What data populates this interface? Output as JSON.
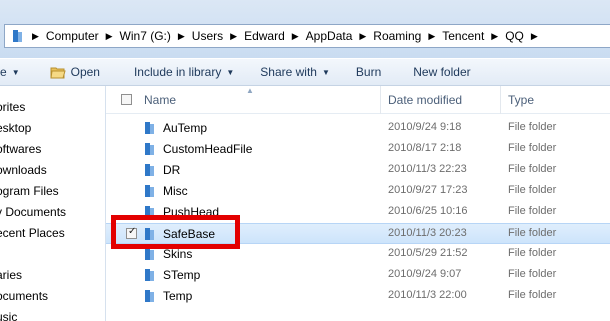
{
  "address": {
    "crumbs": [
      "Computer",
      "Win7 (G:)",
      "Users",
      "Edward",
      "AppData",
      "Roaming",
      "Tencent",
      "QQ"
    ]
  },
  "toolbar": {
    "partial_label": "e",
    "open_label": "Open",
    "include_label": "Include in library",
    "share_label": "Share with",
    "burn_label": "Burn",
    "new_folder_label": "New folder"
  },
  "nav": {
    "items": [
      "orites",
      "esktop",
      "oftwares",
      "ownloads",
      "ogram Files",
      "y Documents",
      "ecent Places",
      "aries",
      "ocuments",
      "usic"
    ]
  },
  "columns": {
    "name": "Name",
    "date": "Date modified",
    "type": "Type"
  },
  "files": [
    {
      "name": "AuTemp",
      "date": "2010/9/24 9:18",
      "type": "File folder"
    },
    {
      "name": "CustomHeadFile",
      "date": "2010/8/17 2:18",
      "type": "File folder"
    },
    {
      "name": "DR",
      "date": "2010/11/3 22:23",
      "type": "File folder"
    },
    {
      "name": "Misc",
      "date": "2010/9/27 17:23",
      "type": "File folder"
    },
    {
      "name": "PushHead",
      "date": "2010/6/25 10:16",
      "type": "File folder"
    },
    {
      "name": "SafeBase",
      "date": "2010/11/3 20:23",
      "type": "File folder"
    },
    {
      "name": "Skins",
      "date": "2010/5/29 21:52",
      "type": "File folder"
    },
    {
      "name": "STemp",
      "date": "2010/9/24 9:07",
      "type": "File folder"
    },
    {
      "name": "Temp",
      "date": "2010/11/3 22:00",
      "type": "File folder"
    }
  ],
  "colors": {
    "highlight_box": "#e30000",
    "selection": "#cde4fb"
  },
  "icons": [
    "folder-icon",
    "caret-down-icon",
    "breadcrumb-arrow-icon"
  ]
}
